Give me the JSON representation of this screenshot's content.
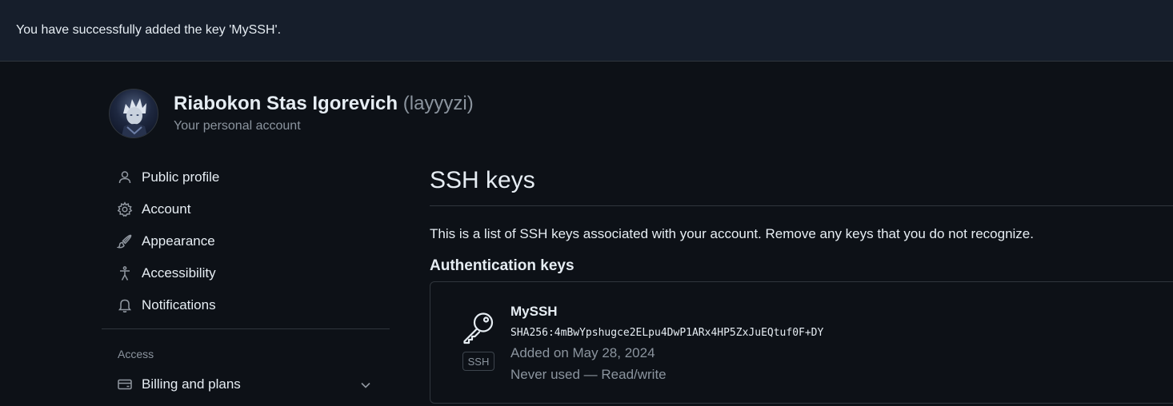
{
  "flash": {
    "message": "You have successfully added the key 'MySSH'."
  },
  "user": {
    "full_name": "Riabokon Stas Igorevich",
    "login": "(layyyzi)",
    "account_type": "Your personal account"
  },
  "sidebar": {
    "items": [
      {
        "label": "Public profile",
        "icon": "person-icon"
      },
      {
        "label": "Account",
        "icon": "gear-icon"
      },
      {
        "label": "Appearance",
        "icon": "paintbrush-icon"
      },
      {
        "label": "Accessibility",
        "icon": "accessibility-icon"
      },
      {
        "label": "Notifications",
        "icon": "bell-icon"
      }
    ],
    "access_heading": "Access",
    "access_items": [
      {
        "label": "Billing and plans",
        "icon": "credit-card-icon"
      }
    ]
  },
  "main": {
    "title": "SSH keys",
    "description": "This is a list of SSH keys associated with your account. Remove any keys that you do not recognize.",
    "section_title": "Authentication keys",
    "keys": [
      {
        "name": "MySSH",
        "fingerprint": "SHA256:4mBwYpshugce2ELpu4DwP1ARx4HP5ZxJuEQtuf0F+DY",
        "added": "Added on May 28, 2024",
        "usage": "Never used — Read/write",
        "badge": "SSH",
        "icon": "key-icon"
      }
    ]
  },
  "colors": {
    "background": "#0d1117",
    "flash_background": "#161e2b",
    "border": "#30363d",
    "text_primary": "#e6edf3",
    "text_muted": "#8b949e"
  }
}
